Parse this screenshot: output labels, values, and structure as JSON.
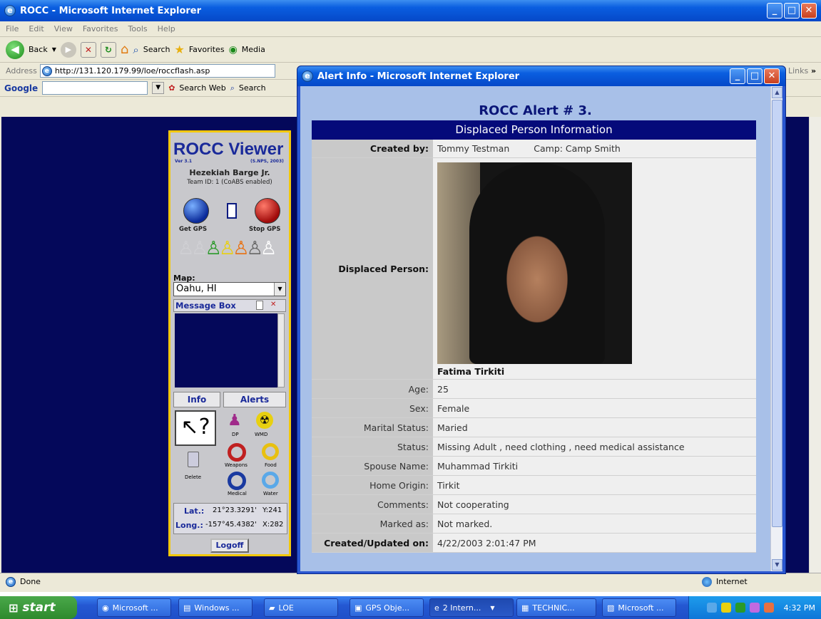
{
  "main_window": {
    "title": "ROCC - Microsoft Internet Explorer",
    "menu": [
      "File",
      "Edit",
      "View",
      "Favorites",
      "Tools",
      "Help"
    ],
    "toolbar": {
      "back": "Back",
      "search": "Search",
      "favorites": "Favorites",
      "media": "Media"
    },
    "address_label": "Address",
    "address_url": "http://131.120.179.99/loe/roccflash.asp",
    "links_label": "Links",
    "google_label": "Google",
    "google_search_web": "Search Web",
    "google_search": "Search",
    "status_text": "Done",
    "zone": "Internet"
  },
  "rocc_viewer": {
    "title": "ROCC Viewer",
    "version": "Ver 3.1",
    "credit": "(S.NPS, 2003)",
    "user_name": "Hezekiah Barge Jr.",
    "team_info": "Team ID: 1  (CoABS enabled)",
    "get_gps": "Get GPS",
    "stop_gps": "Stop GPS",
    "map_label": "Map:",
    "map_selected": "Oahu, HI",
    "message_box": "Message Box",
    "tab_info": "Info",
    "tab_alerts": "Alerts",
    "alert_dp": "DP",
    "alert_wmd": "WMD",
    "alert_weapons": "Weapons",
    "alert_food": "Food",
    "alert_delete": "Delete",
    "alert_medical": "Medical",
    "alert_water": "Water",
    "lat_label": "Lat.:",
    "lat_value": "21°23.3291'",
    "y_label": "Y:241",
    "long_label": "Long.:",
    "long_value": "-157°45.4382'",
    "x_label": "X:282",
    "logoff": "Logoff"
  },
  "popup": {
    "title": "Alert Info - Microsoft Internet Explorer",
    "heading": "ROCC Alert # 3.",
    "section": "Displaced Person Information",
    "created_by_label": "Created by:",
    "created_by_value": "Tommy Testman",
    "camp": "Camp: Camp Smith",
    "person_label": "Displaced Person:",
    "person_name": "Fatima Tirkiti",
    "rows": [
      {
        "label": "Age:",
        "value": "25"
      },
      {
        "label": "Sex:",
        "value": "Female"
      },
      {
        "label": "Marital Status:",
        "value": "Maried"
      },
      {
        "label": "Status:",
        "value": "Missing Adult , need clothing , need medical assistance"
      },
      {
        "label": "Spouse Name:",
        "value": "Muhammad Tirkiti"
      },
      {
        "label": "Home Origin:",
        "value": "Tirkit"
      },
      {
        "label": "Comments:",
        "value": "Not cooperating"
      },
      {
        "label": "Marked as:",
        "value": "Not marked."
      }
    ],
    "updated_label": "Created/Updated on:",
    "updated_value": "4/22/2003 2:01:47 PM"
  },
  "taskbar": {
    "start": "start",
    "tasks": [
      "Microsoft ...",
      "Windows ...",
      "LOE",
      "GPS Obje...",
      "2 Intern...",
      "TECHNIC...",
      "Microsoft ..."
    ],
    "clock": "4:32 PM"
  }
}
